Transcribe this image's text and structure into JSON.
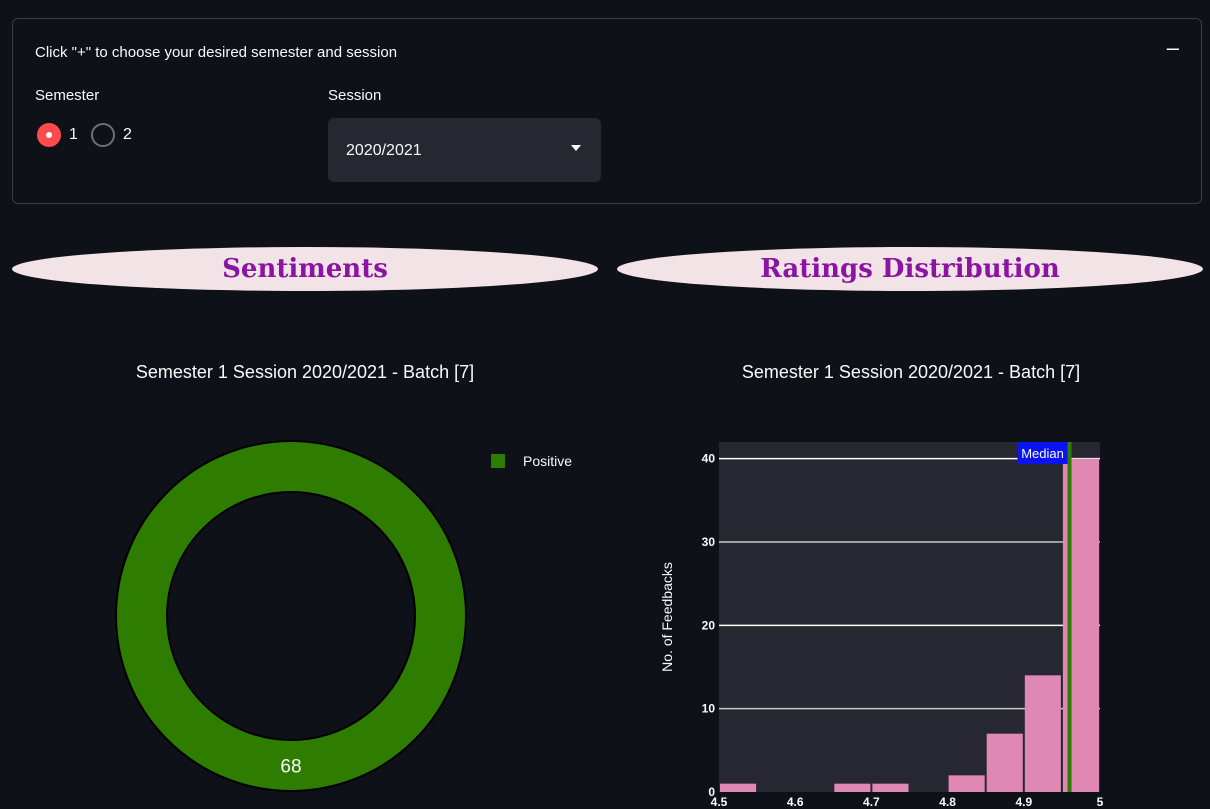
{
  "expander": {
    "title": "Click \"+\" to choose your desired semester and session",
    "toggle_symbol": "–"
  },
  "semester": {
    "label": "Semester",
    "options": [
      "1",
      "2"
    ],
    "selected": "1"
  },
  "session": {
    "label": "Session",
    "value": "2020/2021"
  },
  "banners": {
    "sentiments": "Sentiments",
    "ratings": "Ratings Distribution"
  },
  "colors": {
    "background": "#0e1117",
    "accent_red": "#ff4b4b",
    "positive_green": "#2e7d00",
    "bar_pink": "#e088b4",
    "banner_text": "#8b14a3",
    "median_box": "#0a14f0"
  },
  "chart_data": [
    {
      "type": "pie",
      "title": "Semester 1 Session 2020/2021 - Batch [7]",
      "donut": true,
      "labels": [
        "Positive"
      ],
      "values": [
        68
      ],
      "legend": "top-right"
    },
    {
      "type": "bar",
      "title": "Semester 1 Session 2020/2021 - Batch [7]",
      "xlabel": "",
      "ylabel": "No. of Feedbacks",
      "xlim": [
        4.5,
        5
      ],
      "ylim": [
        0,
        42
      ],
      "x_ticks": [
        "4.5",
        "4.6",
        "4.7",
        "4.8",
        "4.9",
        "5"
      ],
      "y_ticks": [
        "0",
        "10",
        "20",
        "30",
        "40"
      ],
      "bins": [
        {
          "start": 4.5,
          "end": 4.55,
          "count": 1
        },
        {
          "start": 4.55,
          "end": 4.6,
          "count": 0
        },
        {
          "start": 4.6,
          "end": 4.65,
          "count": 0
        },
        {
          "start": 4.65,
          "end": 4.7,
          "count": 1
        },
        {
          "start": 4.7,
          "end": 4.75,
          "count": 1
        },
        {
          "start": 4.75,
          "end": 4.8,
          "count": 0
        },
        {
          "start": 4.8,
          "end": 4.85,
          "count": 2
        },
        {
          "start": 4.85,
          "end": 4.9,
          "count": 7
        },
        {
          "start": 4.9,
          "end": 4.95,
          "count": 14
        },
        {
          "start": 4.95,
          "end": 5.0,
          "count": 40
        }
      ],
      "median": 4.96,
      "median_label": "Median",
      "grid": true
    }
  ]
}
